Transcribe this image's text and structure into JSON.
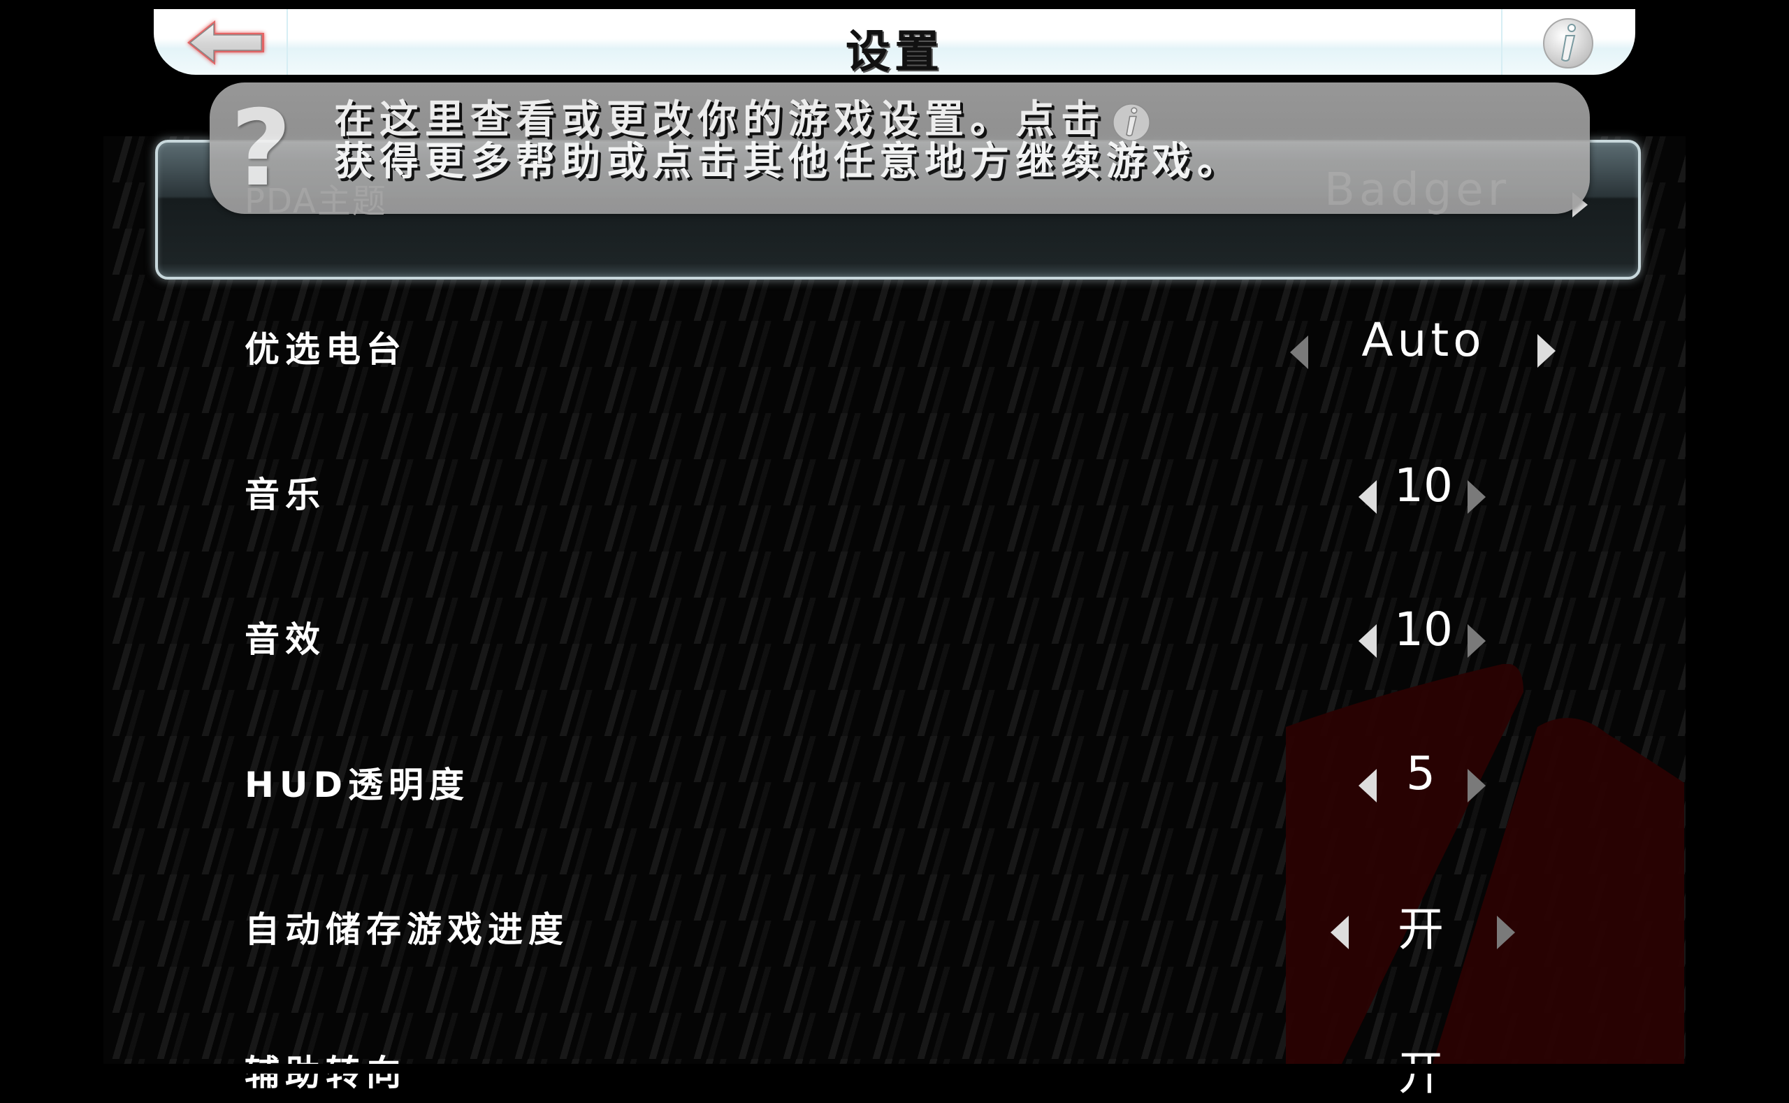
{
  "header": {
    "title": "设置",
    "back_icon": "back-arrow-icon",
    "info_icon": "info-icon"
  },
  "tooltip": {
    "icon": "question-mark-icon",
    "icon_glyph": "?",
    "line1": "在这里查看或更改你的游戏设置。点击",
    "line2": "获得更多帮助或点击其他任意地方继续游戏。"
  },
  "settings": [
    {
      "label": "PDA主题",
      "value": "Badger"
    },
    {
      "label": "优选电台",
      "value": "Auto"
    },
    {
      "label": "音乐",
      "value": "10"
    },
    {
      "label": "音效",
      "value": "10"
    },
    {
      "label": "HUD透明度",
      "value": "5"
    },
    {
      "label": "自动储存游戏进度",
      "value": "开"
    },
    {
      "label": "辅助转向",
      "value": "开"
    }
  ],
  "colors": {
    "header_bg": "#ffffff",
    "tooltip_bg": "#a0a0a0",
    "logo_red": "#2a0202",
    "back_arrow_glow": "#e03030"
  }
}
